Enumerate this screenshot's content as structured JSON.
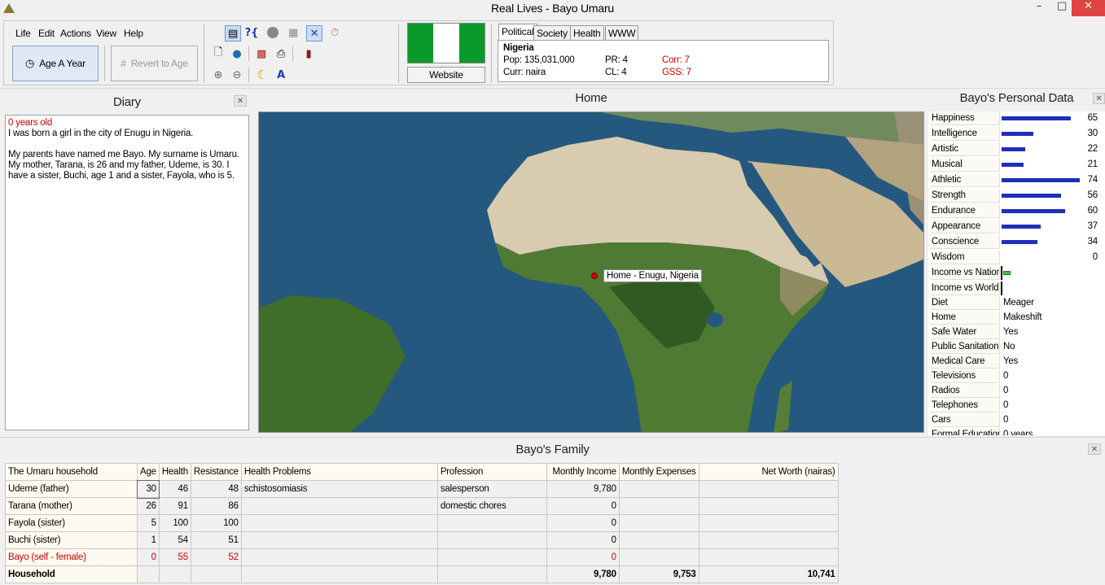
{
  "window": {
    "title": "Real Lives - Bayo Umaru",
    "min_glyph": "–",
    "max_glyph": "□",
    "close_glyph": "✕"
  },
  "menu": [
    "Life",
    "Edit",
    "Actions",
    "View",
    "Help"
  ],
  "toolbar": {
    "age_label": "Age A Year",
    "revert_label": "Revert to Age",
    "website_label": "Website"
  },
  "flag_colors": [
    "#0a9a2a",
    "#ffffff",
    "#0a9a2a"
  ],
  "country": {
    "tabs": [
      "Political",
      "Society",
      "Health",
      "WWW"
    ],
    "active_tab": "Political",
    "name": "Nigeria",
    "pop": "Pop: 135,031,000",
    "curr": "Curr: naira",
    "pr": "PR: 4",
    "cl": "CL: 4",
    "corr": "Corr: 7",
    "gss": "GSS: 7"
  },
  "diary": {
    "title": "Diary",
    "age_line": "0 years old",
    "entry1": "I was born a girl in the city of Enugu in Nigeria.",
    "entry2": "My parents have named me Bayo. My surname is Umaru.  My mother, Tarana, is 26 and my father, Udeme, is 30. I have a sister, Buchi, age 1 and a sister, Fayola, who is 5."
  },
  "map": {
    "title": "Home",
    "marker_label": "Home - Enugu, Nigeria"
  },
  "personal": {
    "title": "Bayo's Personal Data",
    "stats": [
      {
        "label": "Happiness",
        "value": 65
      },
      {
        "label": "Intelligence",
        "value": 30
      },
      {
        "label": "Artistic",
        "value": 22
      },
      {
        "label": "Musical",
        "value": 21
      },
      {
        "label": "Athletic",
        "value": 74
      },
      {
        "label": "Strength",
        "value": 56
      },
      {
        "label": "Endurance",
        "value": 60
      },
      {
        "label": "Appearance",
        "value": 37
      },
      {
        "label": "Conscience",
        "value": 34
      },
      {
        "label": "Wisdom",
        "value": 0
      }
    ],
    "income": [
      {
        "label": "Income vs Nation"
      },
      {
        "label": "Income vs World"
      }
    ],
    "facts": [
      {
        "label": "Diet",
        "value": "Meager"
      },
      {
        "label": "Home",
        "value": "Makeshift"
      },
      {
        "label": "Safe Water",
        "value": "Yes"
      },
      {
        "label": "Public Sanitation",
        "value": "No"
      },
      {
        "label": "Medical Care",
        "value": "Yes"
      },
      {
        "label": "Televisions",
        "value": "0"
      },
      {
        "label": "Radios",
        "value": "0"
      },
      {
        "label": "Telephones",
        "value": "0"
      },
      {
        "label": "Cars",
        "value": "0"
      },
      {
        "label": "Formal Education",
        "value": "0 years"
      }
    ]
  },
  "family": {
    "title": "Bayo's Family",
    "headers": [
      "The Umaru household",
      "Age",
      "Health",
      "Resistance",
      "Health Problems",
      "Profession",
      "Monthly Income",
      "Monthly Expenses",
      "Net Worth (nairas)"
    ],
    "rows": [
      [
        "Udeme (father)",
        "30",
        "46",
        "48",
        "schistosomiasis",
        "salesperson",
        "9,780",
        "",
        ""
      ],
      [
        "Tarana (mother)",
        "26",
        "91",
        "86",
        "",
        "domestic chores",
        "0",
        "",
        ""
      ],
      [
        "Fayola (sister)",
        "5",
        "100",
        "100",
        "",
        "",
        "0",
        "",
        ""
      ],
      [
        "Buchi (sister)",
        "1",
        "54",
        "51",
        "",
        "",
        "0",
        "",
        ""
      ],
      [
        "Bayo (self - female)",
        "0",
        "55",
        "52",
        "",
        "",
        "0",
        "",
        ""
      ],
      [
        "Household",
        "",
        "",
        "",
        "",
        "",
        "9,780",
        "9,753",
        "10,741"
      ]
    ]
  }
}
